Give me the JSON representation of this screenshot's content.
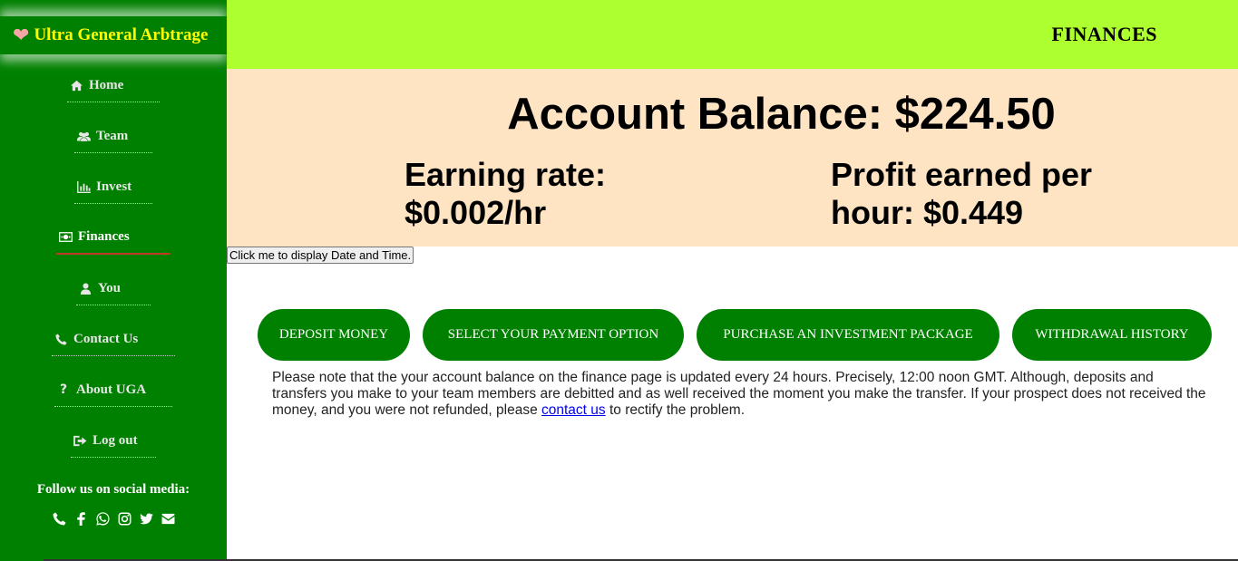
{
  "brand": {
    "name": "Ultra General Arbtrage",
    "icon": "heart-icon"
  },
  "nav": {
    "items": [
      {
        "label": "Home",
        "icon": "home-icon"
      },
      {
        "label": "Team",
        "icon": "users-icon"
      },
      {
        "label": "Invest",
        "icon": "bar-chart-icon"
      },
      {
        "label": "Finances",
        "icon": "money-icon",
        "active": true
      },
      {
        "label": "You",
        "icon": "user-icon"
      },
      {
        "label": "Contact Us",
        "icon": "phone-icon"
      },
      {
        "label": "About UGA",
        "icon": "question-icon"
      },
      {
        "label": "Log out",
        "icon": "sign-out-icon"
      }
    ]
  },
  "social": {
    "title": "Follow us on social media:",
    "icons": [
      "phone-icon",
      "facebook-icon",
      "whatsapp-icon",
      "instagram-icon",
      "twitter-icon",
      "envelope-icon"
    ]
  },
  "header": {
    "title": "FINANCES"
  },
  "balance": {
    "account_balance": "Account Balance: $224.50",
    "earning_rate_line1": "Earning rate:",
    "earning_rate_line2": "$0.002/hr",
    "profit_line1": "Profit earned per",
    "profit_line2": "hour: $0.449"
  },
  "datetime_button": "Click me to display Date and Time.",
  "actions": {
    "deposit": "DEPOSIT MONEY",
    "payment_option": "SELECT YOUR PAYMENT OPTION",
    "purchase": "PURCHASE AN INVESTMENT PACKAGE",
    "withdrawal": "WITHDRAWAL HISTORY"
  },
  "note": {
    "text_before": "Please note that the your account balance on the finance page is updated every 24 hours. Precisely, 12:00 noon GMT. Although, deposits and transfers you make to your team members are debitted and as well received the moment you make the transfer. If your prospect does not received the money, and you were not refunded, please ",
    "link": "contact us",
    "text_after": " to rectify the problem."
  },
  "colors": {
    "sidebar": "#008000",
    "header": "#adff2f",
    "panel": "#ffe4c4",
    "brand_text": "#ffff00",
    "button": "#008000"
  }
}
